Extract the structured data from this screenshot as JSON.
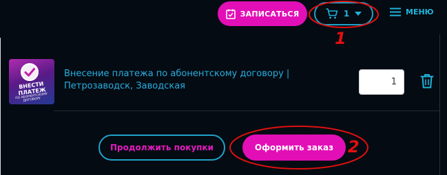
{
  "header": {
    "signup_label": "ЗАПИСАТЬСЯ",
    "cart_count": "1",
    "menu_label": "МЕНЮ"
  },
  "cart": {
    "items": [
      {
        "thumbnail_title": "ВНЕСТИ ПЛАТЕЖ",
        "thumbnail_subtitle": "ПО АБОНЕНТСКОМУ ДОГОВОРУ",
        "title": "Внесение платежа по абонентскому договору | Петрозаводск, Заводская",
        "quantity": "1"
      }
    ]
  },
  "footer": {
    "continue_label": "Продолжить покупки",
    "order_label": "Оформить заказ"
  },
  "annotations": {
    "marker_1": "1",
    "marker_2": "2"
  },
  "colors": {
    "background": "#050b12",
    "accent_pink": "#e20fb6",
    "accent_cyan": "#1fb4dc",
    "annotation_red": "#e01010"
  }
}
